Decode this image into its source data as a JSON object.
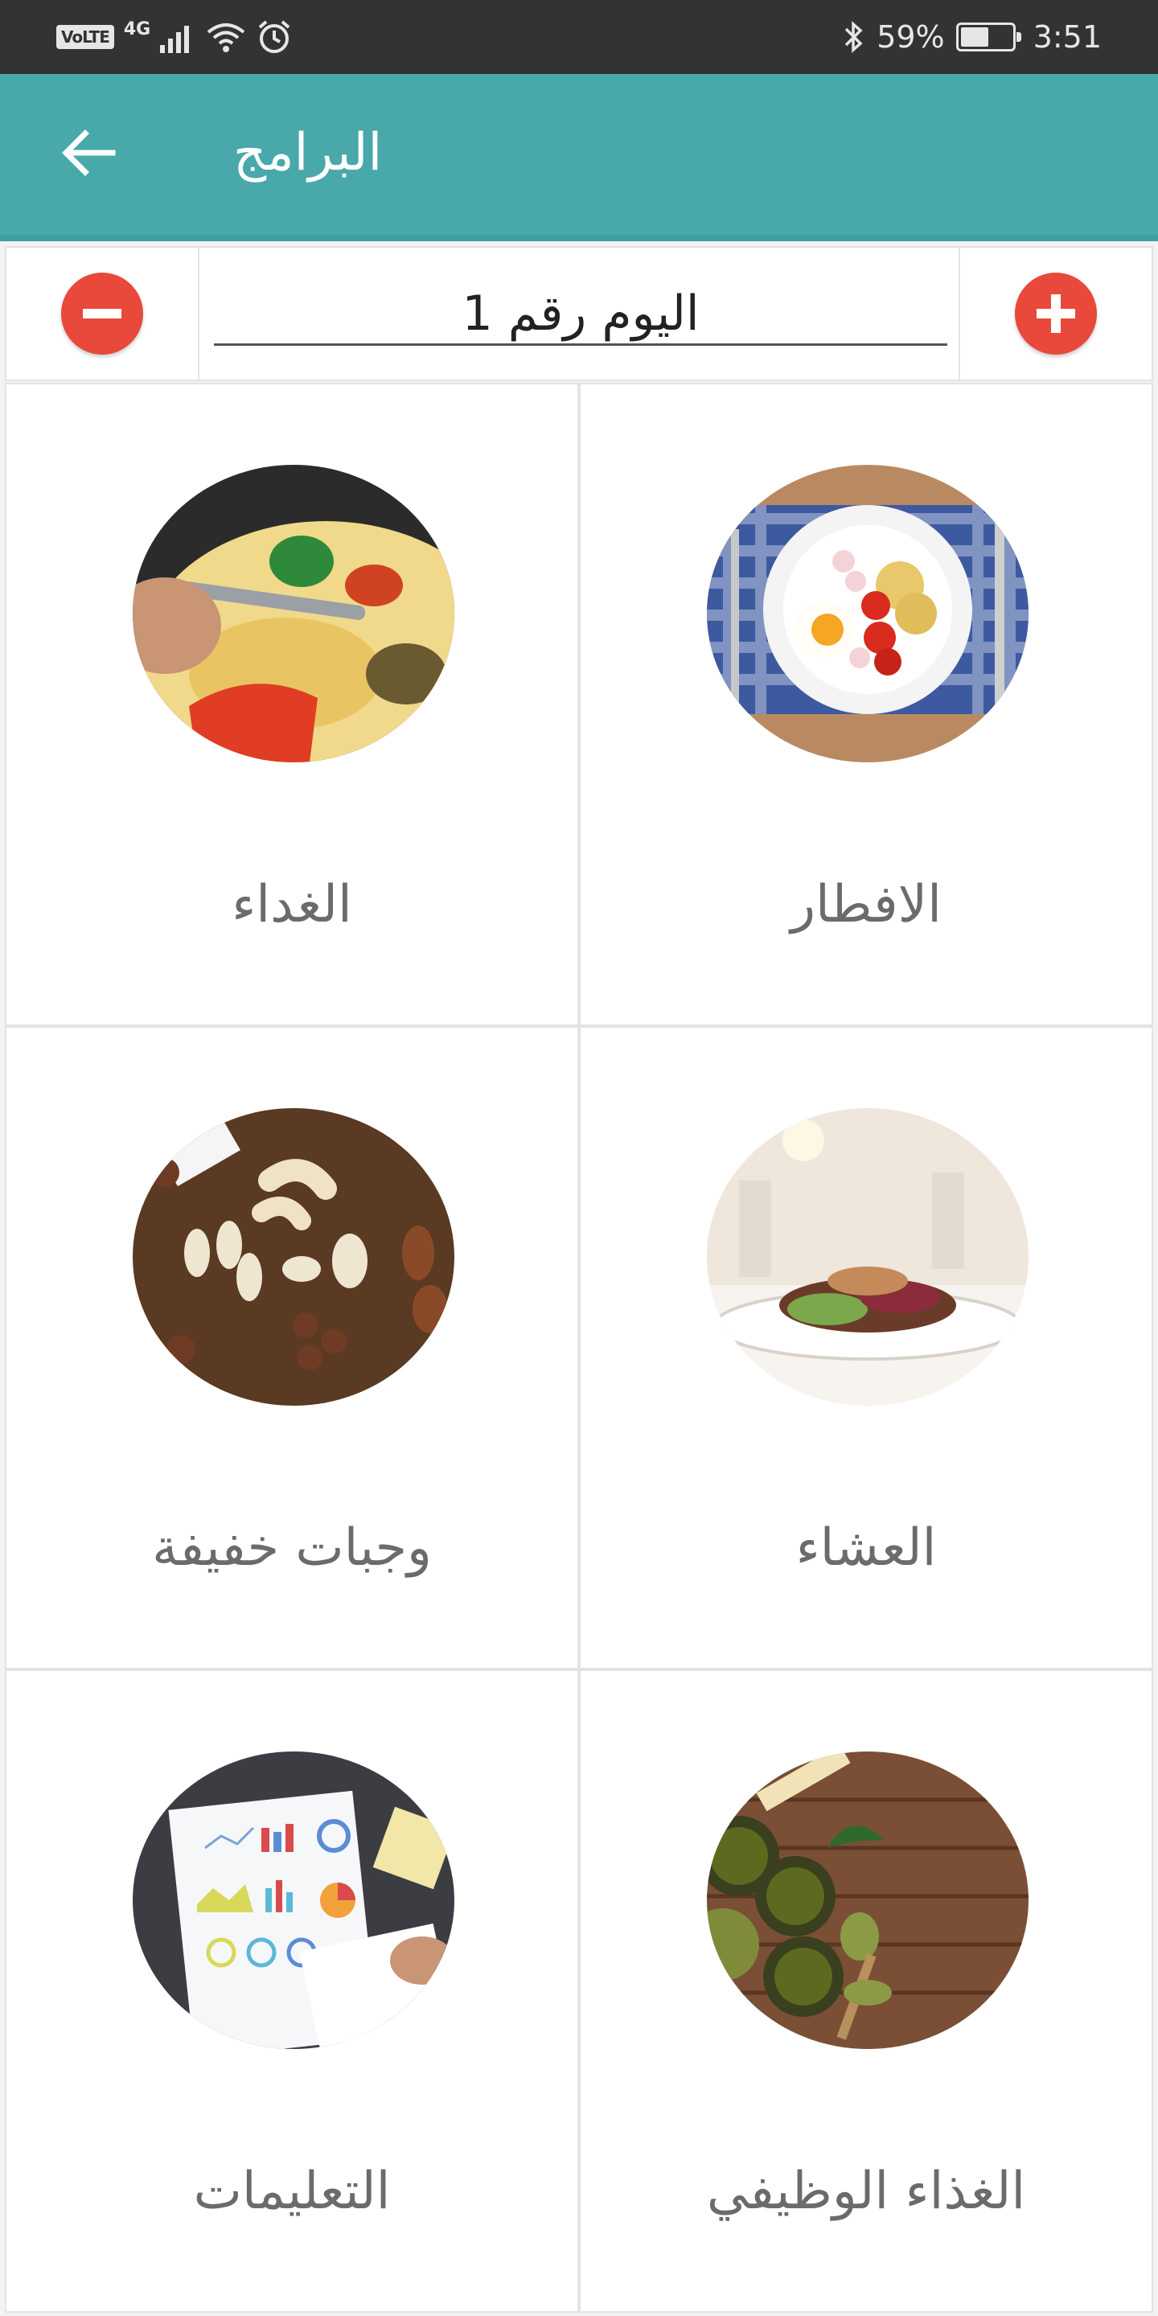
{
  "status_bar": {
    "volte": "VoLTE",
    "network": "4G",
    "battery_percent": "59%",
    "battery_level": 0.59,
    "time": "3:51"
  },
  "app_bar": {
    "title": "البرامج",
    "back_icon": "arrow-left-icon"
  },
  "day_selector": {
    "value": "اليوم رقم 1",
    "remove_icon": "minus-circle-icon",
    "add_icon": "plus-circle-icon"
  },
  "meals": [
    {
      "label": "الافطار",
      "image": "breakfast-plate-photo"
    },
    {
      "label": "الغداء",
      "image": "pasta-fork-photo"
    },
    {
      "label": "العشاء",
      "image": "dinner-plate-photo"
    },
    {
      "label": "وجبات خفيفة",
      "image": "nuts-photo"
    },
    {
      "label": "الغذاء الوظيفي",
      "image": "matcha-powder-photo"
    },
    {
      "label": "التعليمات",
      "image": "charts-notebook-photo"
    }
  ],
  "colors": {
    "app_bar": "#48a8aa",
    "status_bar": "#333333",
    "accent_red": "#e8493a"
  }
}
